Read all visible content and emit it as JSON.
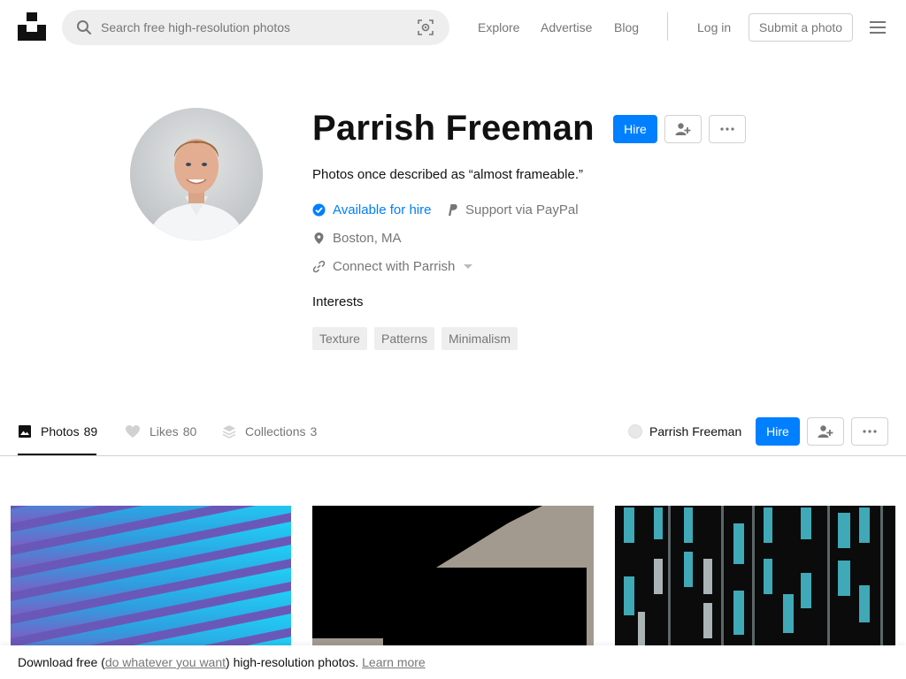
{
  "header": {
    "search_placeholder": "Search free high-resolution photos",
    "nav": [
      "Explore",
      "Advertise",
      "Blog"
    ],
    "login": "Log in",
    "submit": "Submit a photo"
  },
  "profile": {
    "name": "Parrish Freeman",
    "hire": "Hire",
    "bio": "Photos once described as “almost frameable.”",
    "available": "Available for hire",
    "paypal": "Support via PayPal",
    "location": "Boston, MA",
    "connect": "Connect with Parrish",
    "interests_title": "Interests",
    "interests": [
      "Texture",
      "Patterns",
      "Minimalism"
    ]
  },
  "tabs": {
    "photos_label": "Photos",
    "photos_count": "89",
    "likes_label": "Likes",
    "likes_count": "80",
    "collections_label": "Collections",
    "collections_count": "3",
    "user_name": "Parrish Freeman",
    "hire": "Hire"
  },
  "banner": {
    "prefix": "Download free (",
    "link": "do whatever you want",
    "suffix": ") high-resolution photos.",
    "learn_more": "Learn more"
  },
  "colors": {
    "accent": "#007fff",
    "muted_text": "#767676",
    "border": "#d1d1d1"
  }
}
